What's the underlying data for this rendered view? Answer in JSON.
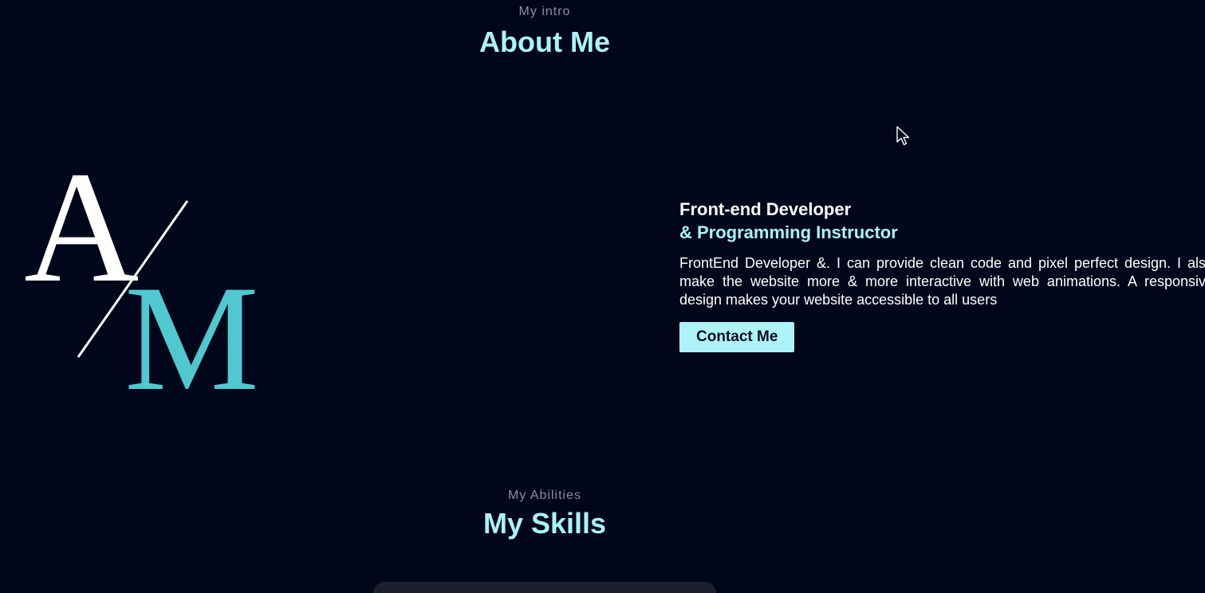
{
  "about": {
    "subtitle": "My intro",
    "title": "About Me",
    "role_line1": "Front-end Developer",
    "role_line2": "& Programming Instructor",
    "description": "FrontEnd Developer &. I can provide clean code and pixel perfect design. I also make the website more & more interactive with web animations. A responsive design makes your website accessible to all users",
    "contact_label": "Contact Me"
  },
  "logo": {
    "letter_a": "A",
    "letter_m": "M"
  },
  "skills": {
    "subtitle": "My Abilities",
    "title": "My Skills"
  },
  "colors": {
    "background": "#02061a",
    "accent": "#a9f4fb",
    "logo_m": "#4fc9cf"
  }
}
